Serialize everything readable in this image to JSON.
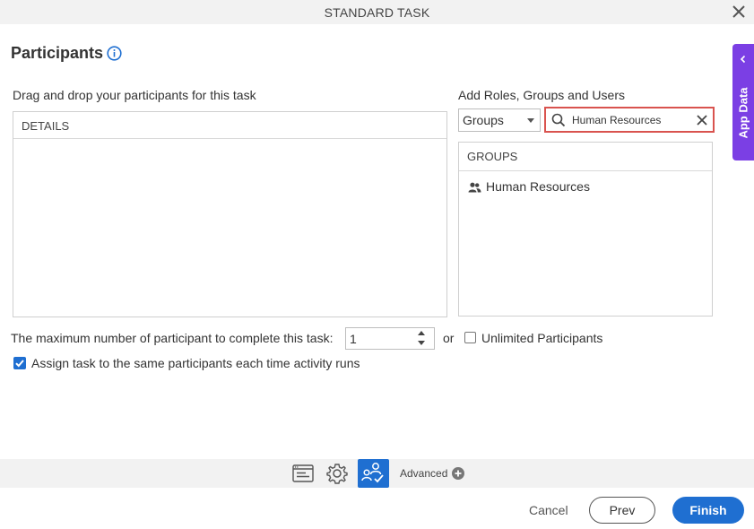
{
  "window": {
    "title": "STANDARD TASK",
    "close_icon": "close-icon"
  },
  "page": {
    "heading": "Participants",
    "info_icon": "info-icon"
  },
  "app_data_tab": {
    "label": "App Data",
    "icon": "chevron-left-icon",
    "color": "#7b3fe4"
  },
  "left_panel": {
    "label": "Drag and drop your participants for this task",
    "details_header": "DETAILS"
  },
  "right_panel": {
    "label": "Add Roles, Groups and Users",
    "type_select": {
      "value": "Groups"
    },
    "search": {
      "value": "Human Resources",
      "icon": "search-icon",
      "clear_icon": "close-icon",
      "highlight_color": "#d9534f"
    },
    "groups_header": "GROUPS",
    "groups": [
      {
        "label": "Human Resources",
        "icon": "group-icon"
      }
    ]
  },
  "max_participants": {
    "label": "The maximum number of participant to complete this task:",
    "value": "1",
    "or_text": "or",
    "unlimited_label": "Unlimited Participants",
    "unlimited_checked": false
  },
  "assign_same": {
    "label": "Assign task to the same participants each time activity runs",
    "checked": true
  },
  "bottom_toolbar": {
    "icons": [
      "form-icon",
      "gear-icon",
      "participants-icon"
    ],
    "active": "participants-icon",
    "advanced_label": "Advanced",
    "advanced_icon": "plus-circle-icon",
    "accent": "#1f6fd1"
  },
  "footer": {
    "cancel_label": "Cancel",
    "prev_label": "Prev",
    "finish_label": "Finish"
  }
}
